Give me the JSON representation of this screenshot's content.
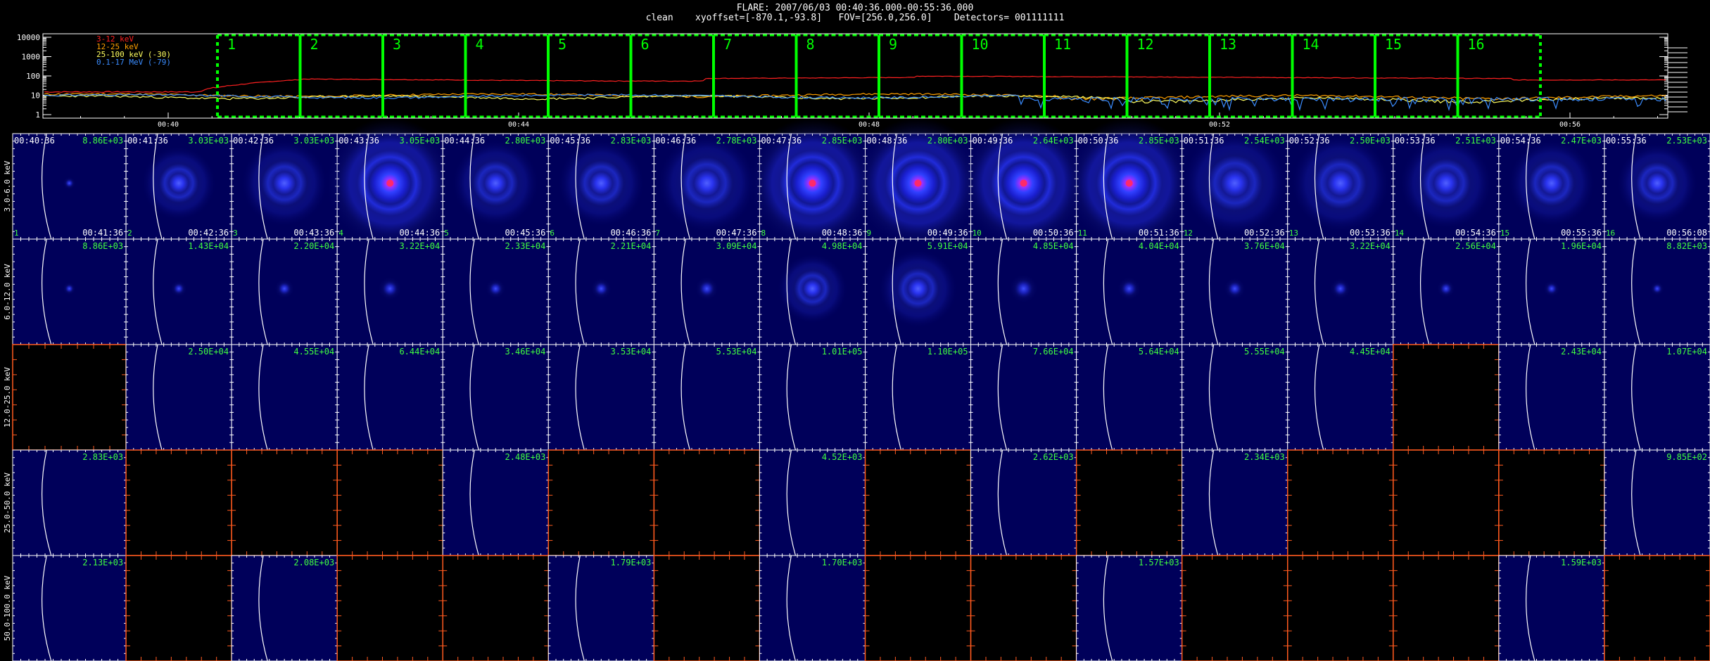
{
  "header": {
    "title": "FLARE: 2007/06/03 00:40:36.000-00:55:36.000",
    "subtitle": "clean    xyoffset=[-870.1,-93.8]   FOV=[256.0,256.0]    Detectors= 001111111"
  },
  "lightcurve": {
    "y_tick_labels": [
      "10000",
      "1000",
      "100",
      "10",
      "1"
    ],
    "x_tick_labels": [
      "00:40",
      "00:44",
      "00:48",
      "00:52",
      "00:56"
    ],
    "legend": [
      {
        "label": "3-12 keV",
        "color": "#ff2020"
      },
      {
        "label": "12-25 keV",
        "color": "#ffa000"
      },
      {
        "label": "25-100 keV (-30)",
        "color": "#ffff60"
      },
      {
        "label": "0.1-17 MeV (-79)",
        "color": "#3a8cff"
      }
    ],
    "interval_labels": [
      "1",
      "2",
      "3",
      "4",
      "5",
      "6",
      "7",
      "8",
      "9",
      "10",
      "11",
      "12",
      "13",
      "14",
      "15",
      "16"
    ],
    "interval_color": "#00ff00"
  },
  "grid": {
    "row_labels": [
      "3.0-6.0 keV",
      "6.0-12.0 keV",
      "12.0-25.0 keV",
      "25.0-50.0 keV",
      "50.0-100.0 keV"
    ],
    "rows": [
      {
        "panels": [
          {
            "max": "8.86E+03",
            "start": "00:40:36",
            "end": "00:41:36",
            "num": "1",
            "i": 0.05
          },
          {
            "max": "3.03E+03",
            "start": "00:41:36",
            "end": "00:42:36",
            "num": "2",
            "i": 0.5
          },
          {
            "max": "3.03E+03",
            "start": "00:42:36",
            "end": "00:43:36",
            "num": "3",
            "i": 0.6
          },
          {
            "max": "3.05E+03",
            "start": "00:43:36",
            "end": "00:44:36",
            "num": "4",
            "i": 0.9
          },
          {
            "max": "2.80E+03",
            "start": "00:44:36",
            "end": "00:45:36",
            "num": "5",
            "i": 0.6
          },
          {
            "max": "2.83E+03",
            "start": "00:45:36",
            "end": "00:46:36",
            "num": "6",
            "i": 0.6
          },
          {
            "max": "2.78E+03",
            "start": "00:46:36",
            "end": "00:47:36",
            "num": "7",
            "i": 0.7
          },
          {
            "max": "2.85E+03",
            "start": "00:47:36",
            "end": "00:48:36",
            "num": "8",
            "i": 1.0
          },
          {
            "max": "2.80E+03",
            "start": "00:48:36",
            "end": "00:49:36",
            "num": "9",
            "i": 1.0
          },
          {
            "max": "2.64E+03",
            "start": "00:49:36",
            "end": "00:50:36",
            "num": "10",
            "i": 0.95
          },
          {
            "max": "2.85E+03",
            "start": "00:50:36",
            "end": "00:51:36",
            "num": "11",
            "i": 0.9
          },
          {
            "max": "2.54E+03",
            "start": "00:51:36",
            "end": "00:52:36",
            "num": "12",
            "i": 0.75
          },
          {
            "max": "2.50E+03",
            "start": "00:52:36",
            "end": "00:53:36",
            "num": "13",
            "i": 0.7
          },
          {
            "max": "2.51E+03",
            "start": "00:53:36",
            "end": "00:54:36",
            "num": "14",
            "i": 0.65
          },
          {
            "max": "2.47E+03",
            "start": "00:54:36",
            "end": "00:55:36",
            "num": "15",
            "i": 0.6
          },
          {
            "max": "2.53E+03",
            "start": "00:55:36",
            "end": "00:56:08",
            "num": "16",
            "i": 0.55
          }
        ]
      },
      {
        "panels": [
          {
            "max": "8.86E+03",
            "i": 0.05
          },
          {
            "max": "1.43E+04",
            "i": 0.15
          },
          {
            "max": "2.20E+04",
            "i": 0.25
          },
          {
            "max": "3.22E+04",
            "i": 0.35
          },
          {
            "max": "2.33E+04",
            "i": 0.25
          },
          {
            "max": "2.21E+04",
            "i": 0.28
          },
          {
            "max": "3.09E+04",
            "i": 0.35
          },
          {
            "max": "4.98E+04",
            "i": 0.7
          },
          {
            "max": "5.91E+04",
            "i": 0.8
          },
          {
            "max": "4.85E+04",
            "i": 0.5
          },
          {
            "max": "4.04E+04",
            "i": 0.35
          },
          {
            "max": "3.76E+04",
            "i": 0.3
          },
          {
            "max": "3.22E+04",
            "i": 0.28
          },
          {
            "max": "2.56E+04",
            "i": 0.2
          },
          {
            "max": "1.96E+04",
            "i": 0.15
          },
          {
            "max": "8.82E+03",
            "i": 0.08
          }
        ]
      },
      {
        "panels": [
          {
            "max": "",
            "i": 0,
            "blank": true
          },
          {
            "max": "2.50E+04",
            "i": 0.02
          },
          {
            "max": "4.55E+04",
            "i": 0.02
          },
          {
            "max": "6.44E+04",
            "i": 0.02
          },
          {
            "max": "3.46E+04",
            "i": 0.02
          },
          {
            "max": "3.53E+04",
            "i": 0.02
          },
          {
            "max": "5.53E+04",
            "i": 0.02
          },
          {
            "max": "1.01E+05",
            "i": 0.02
          },
          {
            "max": "1.10E+05",
            "i": 0.02
          },
          {
            "max": "7.66E+04",
            "i": 0.02
          },
          {
            "max": "5.64E+04",
            "i": 0.02
          },
          {
            "max": "5.55E+04",
            "i": 0.02
          },
          {
            "max": "4.45E+04",
            "i": 0.02
          },
          {
            "max": "",
            "i": 0,
            "blank": true
          },
          {
            "max": "2.43E+04",
            "i": 0.02
          },
          {
            "max": "1.07E+04",
            "i": 0.02
          }
        ]
      },
      {
        "panels": [
          {
            "max": "2.83E+03",
            "i": 0.02
          },
          {
            "max": "",
            "i": 0,
            "blank": true
          },
          {
            "max": "",
            "i": 0,
            "blank": true
          },
          {
            "max": "",
            "i": 0,
            "blank": true
          },
          {
            "max": "2.48E+03",
            "i": 0.02
          },
          {
            "max": "",
            "i": 0,
            "blank": true
          },
          {
            "max": "",
            "i": 0,
            "blank": true
          },
          {
            "max": "4.52E+03",
            "i": 0.02
          },
          {
            "max": "",
            "i": 0,
            "blank": true
          },
          {
            "max": "2.62E+03",
            "i": 0.02
          },
          {
            "max": "",
            "i": 0,
            "blank": true
          },
          {
            "max": "2.34E+03",
            "i": 0.02
          },
          {
            "max": "",
            "i": 0,
            "blank": true
          },
          {
            "max": "",
            "i": 0,
            "blank": true
          },
          {
            "max": "",
            "i": 0,
            "blank": true
          },
          {
            "max": "9.85E+02",
            "i": 0.02
          }
        ]
      },
      {
        "panels": [
          {
            "max": "2.13E+03",
            "i": 0.02
          },
          {
            "max": "",
            "i": 0,
            "blank": true
          },
          {
            "max": "2.08E+03",
            "i": 0.02
          },
          {
            "max": "",
            "i": 0,
            "blank": true
          },
          {
            "max": "",
            "i": 0,
            "blank": true
          },
          {
            "max": "1.79E+03",
            "i": 0.02
          },
          {
            "max": "",
            "i": 0,
            "blank": true
          },
          {
            "max": "1.70E+03",
            "i": 0.02
          },
          {
            "max": "",
            "i": 0,
            "blank": true
          },
          {
            "max": "",
            "i": 0,
            "blank": true
          },
          {
            "max": "1.57E+03",
            "i": 0.02
          },
          {
            "max": "",
            "i": 0,
            "blank": true
          },
          {
            "max": "",
            "i": 0,
            "blank": true
          },
          {
            "max": "",
            "i": 0,
            "blank": true
          },
          {
            "max": "1.59E+03",
            "i": 0.02
          },
          {
            "max": "",
            "i": 0,
            "blank": true
          }
        ]
      }
    ]
  }
}
